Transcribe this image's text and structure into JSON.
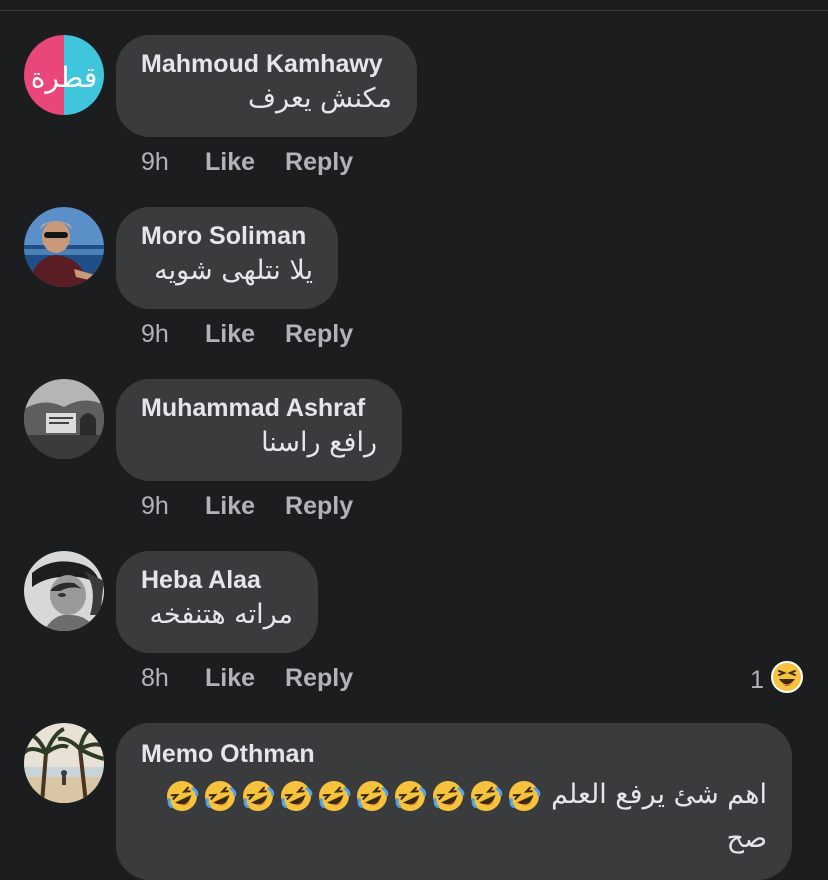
{
  "comments": [
    {
      "author": "Mahmoud Kamhawy",
      "text": "مكنش يعرف",
      "time": "9h",
      "like_label": "Like",
      "reply_label": "Reply",
      "avatar_icon": "qatra-logo-avatar",
      "avatar_text": "قطرة"
    },
    {
      "author": "Moro Soliman",
      "text": "يلا نتلهى شويه",
      "time": "9h",
      "like_label": "Like",
      "reply_label": "Reply",
      "avatar_icon": "man-sunglasses-avatar"
    },
    {
      "author": "Muhammad Ashraf",
      "text": "رافع راسنا",
      "time": "9h",
      "like_label": "Like",
      "reply_label": "Reply",
      "avatar_icon": "grayscale-photo-avatar"
    },
    {
      "author": "Heba Alaa",
      "text": "مراته هتنفخه",
      "time": "8h",
      "like_label": "Like",
      "reply_label": "Reply",
      "avatar_icon": "bw-portrait-avatar",
      "reaction_count": "1",
      "reaction_icon": "laughing-face-icon"
    },
    {
      "author": "Memo Othman",
      "text_line1": "اهم شئ يرفع العلم",
      "text_line2": "صح",
      "emoji_count": 10,
      "emoji_icon": "rolling-on-floor-laughing-icon",
      "avatar_icon": "palm-trees-beach-avatar"
    }
  ],
  "colors": {
    "background": "#1c1d1f",
    "bubble": "#3a3b3c",
    "primary_text": "#e4e6eb",
    "secondary_text": "#b0b3b8",
    "emoji_yellow": "#f7c23c"
  }
}
